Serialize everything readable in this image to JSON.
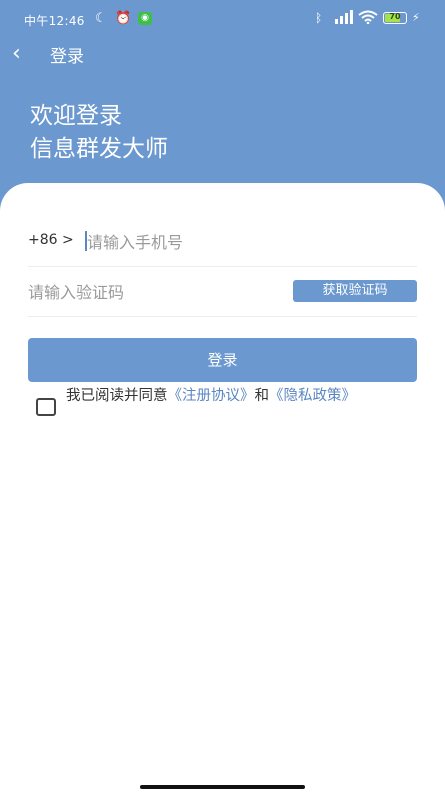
{
  "status_bar": {
    "time": "中午12:46",
    "moon_icon": "moon-icon",
    "alarm_icon": "alarm-icon",
    "app_badge": "wechat-icon",
    "bluetooth_icon": "bluetooth-icon",
    "signal_icon": "signal-icon",
    "wifi_icon": "wifi-icon",
    "battery": "70",
    "charging_icon": "bolt-icon"
  },
  "nav": {
    "back_icon": "chevron-left-icon",
    "back_glyph": "‹",
    "title": "登录"
  },
  "welcome": {
    "line1": "欢迎登录",
    "line2": "信息群发大师"
  },
  "form": {
    "country_code": "+86 >",
    "phone_placeholder": "请输入手机号",
    "code_placeholder": "请输入验证码",
    "get_code_label": "获取验证码",
    "login_label": "登录"
  },
  "agreement": {
    "prefix": "我已阅读并同意",
    "terms_link": "《注册协议》",
    "and": "和",
    "privacy_link": "《隐私政策》",
    "checked": false
  },
  "colors": {
    "primary": "#6b98cf",
    "link": "#5b86c1"
  }
}
